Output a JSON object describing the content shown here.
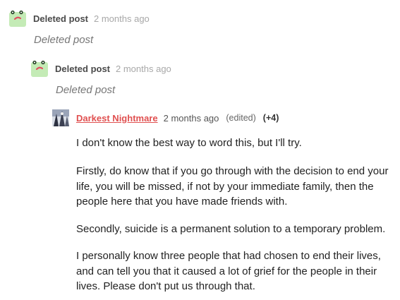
{
  "comments": [
    {
      "author": "Deleted post",
      "time": "2 months ago",
      "body": "Deleted post",
      "avatar_icon": "frog-avatar-icon"
    },
    {
      "author": "Deleted post",
      "time": "2 months ago",
      "body": "Deleted post",
      "avatar_icon": "frog-avatar-icon"
    },
    {
      "author": "Darkest Nightmare",
      "time": "2 months ago",
      "edited": "(edited)",
      "score": "(+4)",
      "avatar_icon": "user-avatar-icon",
      "paragraphs": [
        "I don't know the best way to word this, but I'll try.",
        "Firstly, do know that if you go through with the decision to end your life, you will be missed, if not by your immediate family, then the people here that you have made friends with.",
        "Secondly, suicide is a permanent solution to a temporary problem.",
        "I personally know three people that had chosen to end their lives, and can tell you that it caused a lot of grief for the people in their lives. Please don't put us through that."
      ]
    }
  ],
  "colors": {
    "author_link": "#e05050",
    "avatar_green": "#bfe8b0",
    "muted_text": "#a8a8a8"
  }
}
